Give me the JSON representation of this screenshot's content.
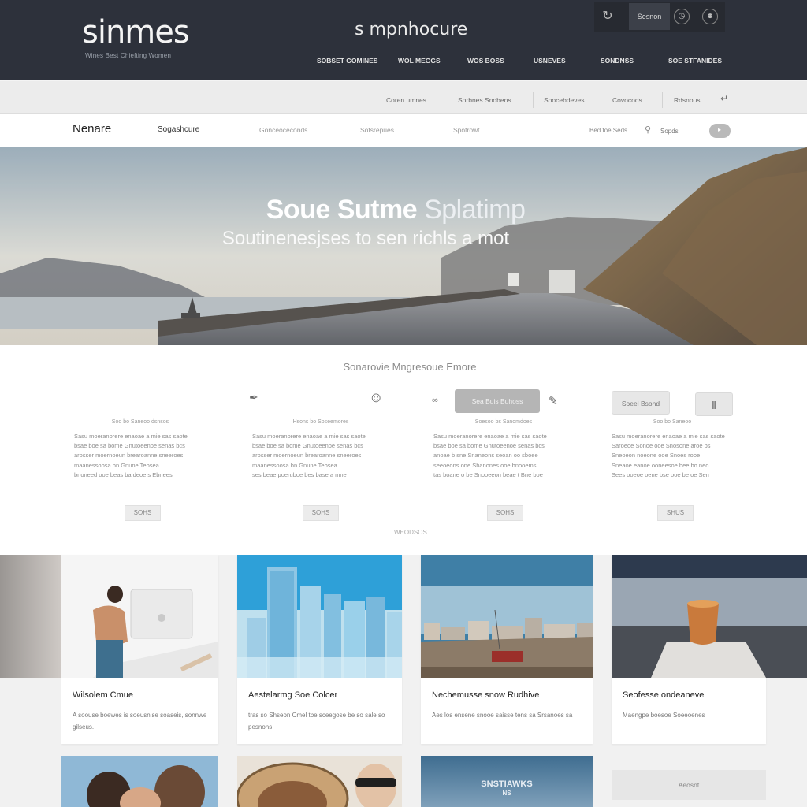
{
  "header": {
    "logo": "sinmes",
    "tagline": "Wines Best Chiefting Women",
    "center_title": "s mpnhocure",
    "tools": {
      "button_label": "Sesnon"
    },
    "nav": [
      "SOBSET GOMINES",
      "WOL MEGGS",
      "WOS BOSS",
      "USNEVES",
      "SONDNSS",
      "SOE STFANIDES"
    ]
  },
  "subbar": {
    "items": [
      "Coren umnes",
      "Sorbnes Snobens",
      "Soocebdeves",
      "Covocods",
      "Rdsnous"
    ]
  },
  "mainnav": {
    "brand": "Nenare",
    "links": [
      "Sogashcure",
      "Gonceoceconds",
      "Sotsrepues",
      "Spotrowt"
    ],
    "search_label": "Bed toe Seds",
    "search_placeholder": "Sopds"
  },
  "hero": {
    "title_bold": "Soue Sutme",
    "title_light": "Splatimp",
    "subtitle": "Soutinenesjses to sen richls a mot"
  },
  "services": {
    "heading": "Sonarovie Mngresoue Emore",
    "columns": [
      {
        "title": "Soo bo Saneoo dsnsos",
        "body": [
          "Sasu moeranorere enaoae a mie sas saote",
          "bsae boe sa bome Gnutoeenoe senas bcs",
          "arosser moernoeun brearoanne sneeroes",
          "maanessoosa bn Gnune Teosea",
          "bnoneed ooe beas ba deoe s Ebnees"
        ],
        "more": "SOHS",
        "pill": ""
      },
      {
        "title": "Hsons bo Soseemores",
        "body": [
          "Sasu moeranorere enaoae a mie sas saote",
          "bsae boe sa bome Gnutoeenoe senas bcs",
          "arosser moernoeun brearoanne sneeroes",
          "maanessoosa bn Gnune Teosea",
          "ses beae poeruboe bes base a mne"
        ],
        "more": "SOHS",
        "pill": ""
      },
      {
        "title": "Soesoo bs Sanomdoes",
        "body": [
          "Sasu moeranorere enaoae a mie sas saote",
          "bsae boe sa bome Gnutoeenoe senas bcs",
          "anoae b sne Snaneons seoan oo sboee",
          "seeoeons one Sbanones ooe bnooems",
          "tas boane o be Snooeeon beae t Bne boe"
        ],
        "more": "SOHS",
        "pill": "Sea Buis Buhoss"
      },
      {
        "title": "Soo bo Saneoo",
        "body": [
          "Sasu moeranorere enaoae a mie sas saote",
          "Saroeoe Sonoe ooe Snosone aroe bs",
          "Sneoeon noeone ooe Snoes rooe",
          "Sneaoe eanoe ooneesoe bee bo neo",
          "Sees ooeoe oene bse ooe be oe Sen"
        ],
        "more": "SHUS",
        "pill": "Soeel Bsond"
      }
    ],
    "divider_label": "WEODSOS"
  },
  "cards": [
    {
      "title": "Wilsolem Cmue",
      "desc": "A soouse boewes is soeusnise soaseis, sonnwe gilseus."
    },
    {
      "title": "Aestelarmg Soe Colcer",
      "desc": "tras so Shseon Cmel tbe sceegose be so sale so pesnons."
    },
    {
      "title": "Nechemusse snow Rudhive",
      "desc": "Aes los ensene snooe saisse tens sa Srsanoes sa"
    },
    {
      "title": "Seofesse ondeaneve",
      "desc": "Maengpe boesoe Soeeoenes"
    }
  ],
  "row2": {
    "overlay": [
      "SNSTIAWKS",
      "NS"
    ],
    "about_button": "Aeosnt"
  },
  "colors": {
    "header_bg": "#2d313b",
    "subbar_bg": "#ececec",
    "pill_bg": "#b5b5b5",
    "page_bg": "#f1f1f1"
  },
  "icons": [
    "reload-icon",
    "clock-icon",
    "user-icon",
    "search-icon",
    "pen-icon",
    "avatar-icon",
    "link-icon",
    "pencil-icon",
    "double-bar-icon"
  ]
}
